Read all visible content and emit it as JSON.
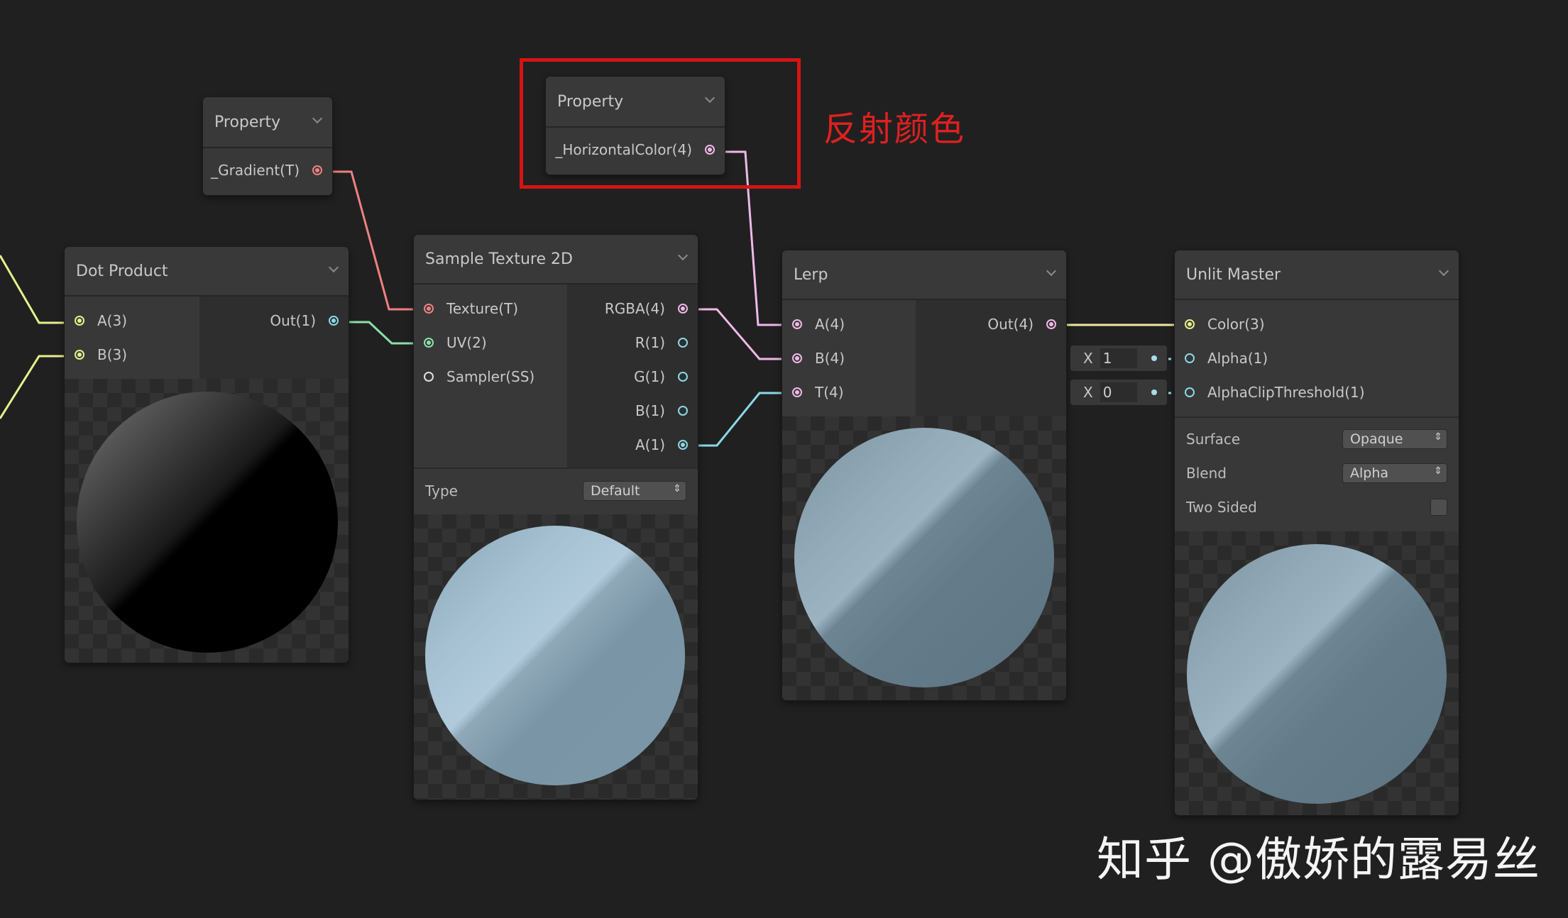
{
  "colors": {
    "background": "#202020",
    "port_texture": "#f08080",
    "port_vector": "#e6f08a",
    "port_uv": "#8ce0a8",
    "port_float": "#8ad8e8",
    "port_vec4": "#f0b8e8",
    "port_sampler": "#e0e0e0",
    "annotation": "#e02020"
  },
  "nodes": {
    "property_gradient": {
      "title": "Property",
      "output": "_Gradient(T)"
    },
    "property_color": {
      "title": "Property",
      "output": "_HorizontalColor(4)"
    },
    "dot_product": {
      "title": "Dot Product",
      "inputs": [
        "A(3)",
        "B(3)"
      ],
      "output": "Out(1)"
    },
    "sample_texture": {
      "title": "Sample Texture 2D",
      "inputs": [
        "Texture(T)",
        "UV(2)",
        "Sampler(SS)"
      ],
      "outputs": [
        "RGBA(4)",
        "R(1)",
        "G(1)",
        "B(1)",
        "A(1)"
      ],
      "type_label": "Type",
      "type_value": "Default"
    },
    "lerp": {
      "title": "Lerp",
      "inputs": [
        "A(4)",
        "B(4)",
        "T(4)"
      ],
      "output": "Out(4)"
    },
    "unlit_master": {
      "title": "Unlit Master",
      "inputs": [
        "Color(3)",
        "Alpha(1)",
        "AlphaClipThreshold(1)"
      ],
      "surface_label": "Surface",
      "surface_value": "Opaque",
      "blend_label": "Blend",
      "blend_value": "Alpha",
      "two_sided_label": "Two Sided",
      "two_sided": false
    }
  },
  "inline_values": {
    "alpha": {
      "axis": "X",
      "value": "1"
    },
    "alpha_clip": {
      "axis": "X",
      "value": "0"
    }
  },
  "annotation": {
    "text": "反射颜色"
  },
  "watermark": "知乎 @傲娇的露易丝"
}
